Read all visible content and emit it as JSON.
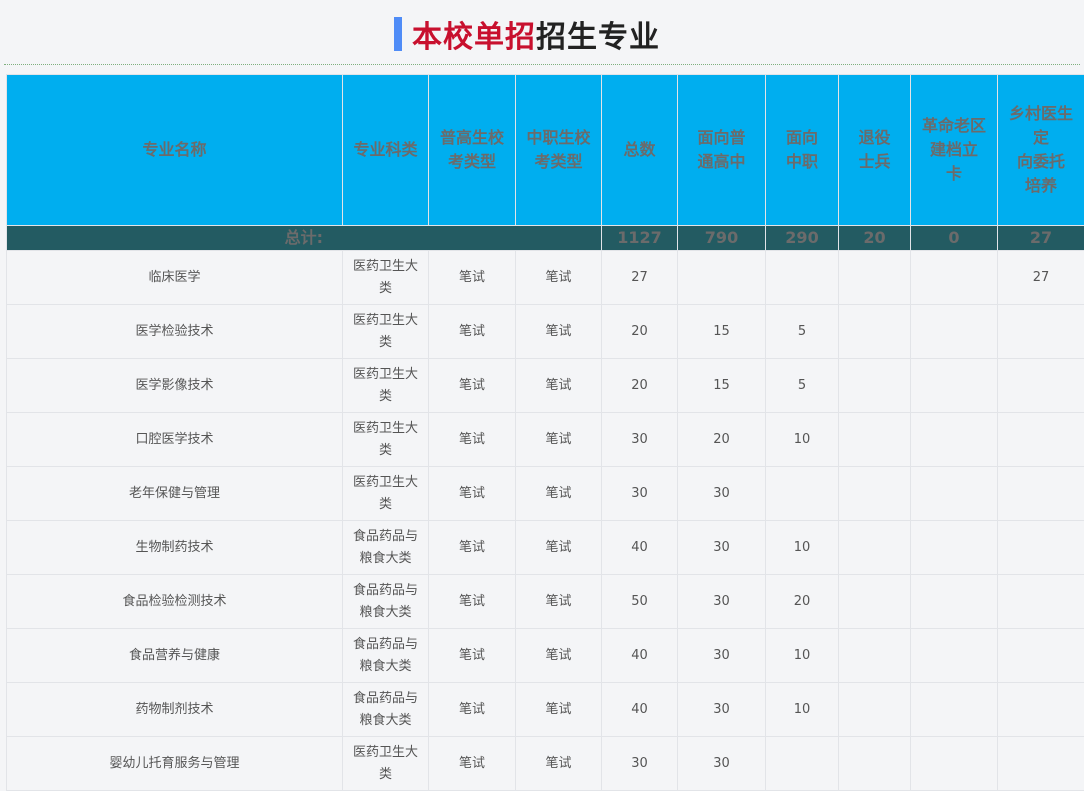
{
  "title": {
    "highlight": "本校单招",
    "rest": "招生专业"
  },
  "table": {
    "headers": [
      "专业名称",
      "专业科类",
      "普高生校\n考类型",
      "中职生校\n考类型",
      "总数",
      "面向普\n通高中",
      "面向\n中职",
      "退役\n士兵",
      "革命老区\n建档立\n卡",
      "乡村医生\n定\n向委托\n培养"
    ],
    "total": {
      "label": "总计:",
      "values": [
        "1127",
        "790",
        "290",
        "20",
        "0",
        "27"
      ]
    },
    "rows": [
      [
        "临床医学",
        "医药卫生大类",
        "笔试",
        "笔试",
        "27",
        "",
        "",
        "",
        "",
        "27"
      ],
      [
        "医学检验技术",
        "医药卫生大类",
        "笔试",
        "笔试",
        "20",
        "15",
        "5",
        "",
        "",
        ""
      ],
      [
        "医学影像技术",
        "医药卫生大类",
        "笔试",
        "笔试",
        "20",
        "15",
        "5",
        "",
        "",
        ""
      ],
      [
        "口腔医学技术",
        "医药卫生大类",
        "笔试",
        "笔试",
        "30",
        "20",
        "10",
        "",
        "",
        ""
      ],
      [
        "老年保健与管理",
        "医药卫生大类",
        "笔试",
        "笔试",
        "30",
        "30",
        "",
        "",
        "",
        ""
      ],
      [
        "生物制药技术",
        "食品药品与粮食大类",
        "笔试",
        "笔试",
        "40",
        "30",
        "10",
        "",
        "",
        ""
      ],
      [
        "食品检验检测技术",
        "食品药品与粮食大类",
        "笔试",
        "笔试",
        "50",
        "30",
        "20",
        "",
        "",
        ""
      ],
      [
        "食品营养与健康",
        "食品药品与粮食大类",
        "笔试",
        "笔试",
        "40",
        "30",
        "10",
        "",
        "",
        ""
      ],
      [
        "药物制剂技术",
        "食品药品与粮食大类",
        "笔试",
        "笔试",
        "40",
        "30",
        "10",
        "",
        "",
        ""
      ],
      [
        "婴幼儿托育服务与管理",
        "医药卫生大类",
        "笔试",
        "笔试",
        "30",
        "30",
        "",
        "",
        "",
        ""
      ]
    ]
  },
  "colors": {
    "header_bg": "#00aeef",
    "total_bg": "#235b62",
    "title_red": "#c8102e",
    "accent": "#4f8cf7"
  }
}
